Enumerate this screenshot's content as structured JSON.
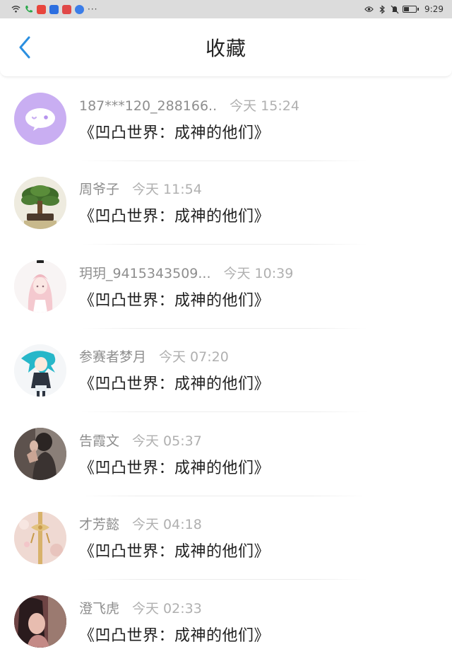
{
  "status_bar": {
    "time": "9:29",
    "dots": "···"
  },
  "header": {
    "title": "收藏"
  },
  "items": [
    {
      "username": "187***120_288166..",
      "time": "今天 15:24",
      "title": "《凹凸世界：成神的他们》"
    },
    {
      "username": "周爷子",
      "time": "今天 11:54",
      "title": "《凹凸世界：成神的他们》"
    },
    {
      "username": "玥玥_9415343509...",
      "time": "今天 10:39",
      "title": "《凹凸世界：成神的他们》"
    },
    {
      "username": "参赛者梦月",
      "time": "今天 07:20",
      "title": "《凹凸世界：成神的他们》"
    },
    {
      "username": "告霞文",
      "time": "今天 05:37",
      "title": "《凹凸世界：成神的他们》"
    },
    {
      "username": "才芳懿",
      "time": "今天 04:18",
      "title": "《凹凸世界：成神的他们》"
    },
    {
      "username": "澄飞虎",
      "time": "今天 02:33",
      "title": "《凹凸世界：成神的他们》"
    }
  ],
  "colors": {
    "accent": "#2b8fe0",
    "status_bar_bg": "#dcdcdc"
  }
}
